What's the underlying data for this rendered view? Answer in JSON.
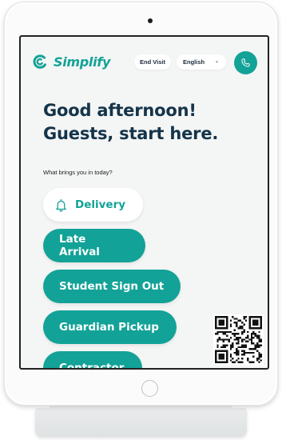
{
  "brand": {
    "name": "Simplify",
    "accent_color": "#13a297",
    "text_color": "#14344a"
  },
  "header": {
    "end_visit_label": "End Visit",
    "language_value": "English",
    "call_icon": "phone-icon"
  },
  "main": {
    "greeting_line1": "Good afternoon!",
    "greeting_line2": "Guests, start here.",
    "prompt": "What brings you in today?",
    "options": [
      {
        "label": "Delivery",
        "icon": "bell-icon",
        "selected": true
      },
      {
        "label": "Late Arrival"
      },
      {
        "label": "Student Sign Out"
      },
      {
        "label": "Guardian Pickup"
      },
      {
        "label": "Contractor"
      }
    ]
  },
  "qr_icon": "qr-code"
}
